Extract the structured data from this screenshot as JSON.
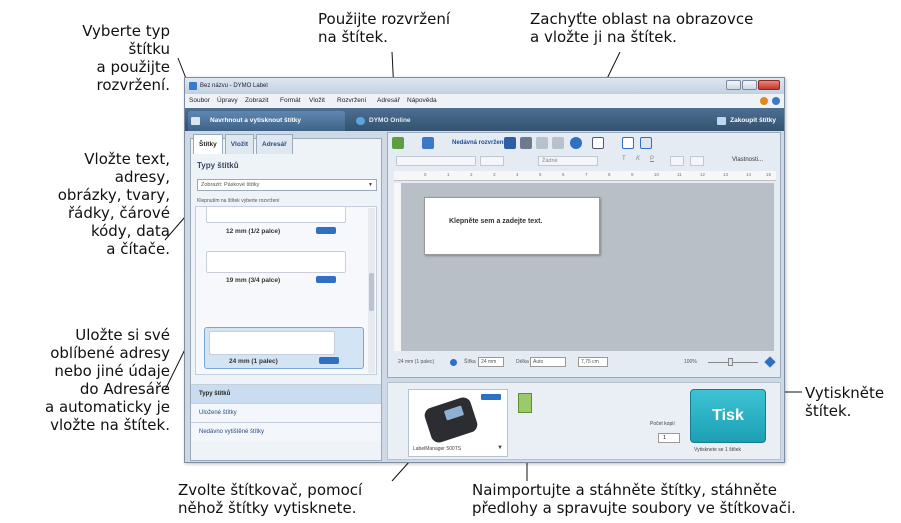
{
  "callouts": {
    "label_type": "Vyberte typ\nštítku\na použijte\nrozvržení.",
    "insert_text": "Vložte text,\nadresy,\nobrázky, tvary,\nřádky, čárové\nkódy, data\na čítače.",
    "addressbook": "Uložte si své\noblíbené adresy\nnebo jiné údaje\ndo Adresáře\na automaticky je\nvložte na štítek.",
    "use_layout": "Použijte rozvržení\nna štítek.",
    "capture": "Zachyťte oblast na obrazovce\na vložte ji na štítek.",
    "print": "Vytiskněte\nštítek.",
    "printer": "Zvolte štítkovač, pomocí\nněhož štítky vytisknete.",
    "import": "Naimportujte a stáhněte štítky, stáhněte\npředlohy a spravujte soubory ve štítkovači."
  },
  "window": {
    "title": "Bez názvu - DYMO Label",
    "menu": [
      "Soubor",
      "Úpravy",
      "Zobrazit",
      "Formát",
      "Vložit",
      "Rozvržení",
      "Adresář",
      "Nápověda"
    ]
  },
  "tabs": {
    "design_print": "Navrhnout a vytisknout štítky",
    "online": "DYMO Online",
    "buy": "Zakoupit štítky"
  },
  "left": {
    "tabs": [
      "Štítky",
      "Vložit",
      "Adresář"
    ],
    "title": "Typy štítků",
    "select_label": "Zobrazit:",
    "select_value": "Páskové štítky",
    "hint": "Klepnutím na štítek vyberte rozvržení",
    "labels": [
      "12 mm (1/2 palce)",
      "19 mm (3/4 palce)",
      "24 mm (1 palec)"
    ],
    "accordion": [
      "Typy štítků",
      "Uložené štítky",
      "Nedávno vytištěné štítky"
    ]
  },
  "toolbar": {
    "recent_layouts": "Nedávná rozvržení",
    "style_placeholder": "Žádné",
    "properties": "Vlastnosti..."
  },
  "ruler_ticks": [
    "0",
    "1",
    "2",
    "3",
    "4",
    "5",
    "6",
    "7",
    "8",
    "9",
    "10",
    "11",
    "12",
    "13",
    "14",
    "15"
  ],
  "canvas": {
    "prompt": "Klepněte sem a zadejte text."
  },
  "status": {
    "size": "24 mm (1 palec)",
    "width_label": "Šířka",
    "width_value": "24 mm",
    "length_label": "Délka",
    "length_value": "Auto",
    "length_mm": "7,75 cm",
    "zoom": "100%"
  },
  "bottom": {
    "printer": "LabelManager 500TS",
    "copies_label": "Počet kopií",
    "copies_value": "1",
    "print_button": "Tisk",
    "print_caption": "Vytisknete se 1 štítek"
  },
  "colors": {
    "accent": "#1c9fb4",
    "tabbar": "#3f6388"
  }
}
